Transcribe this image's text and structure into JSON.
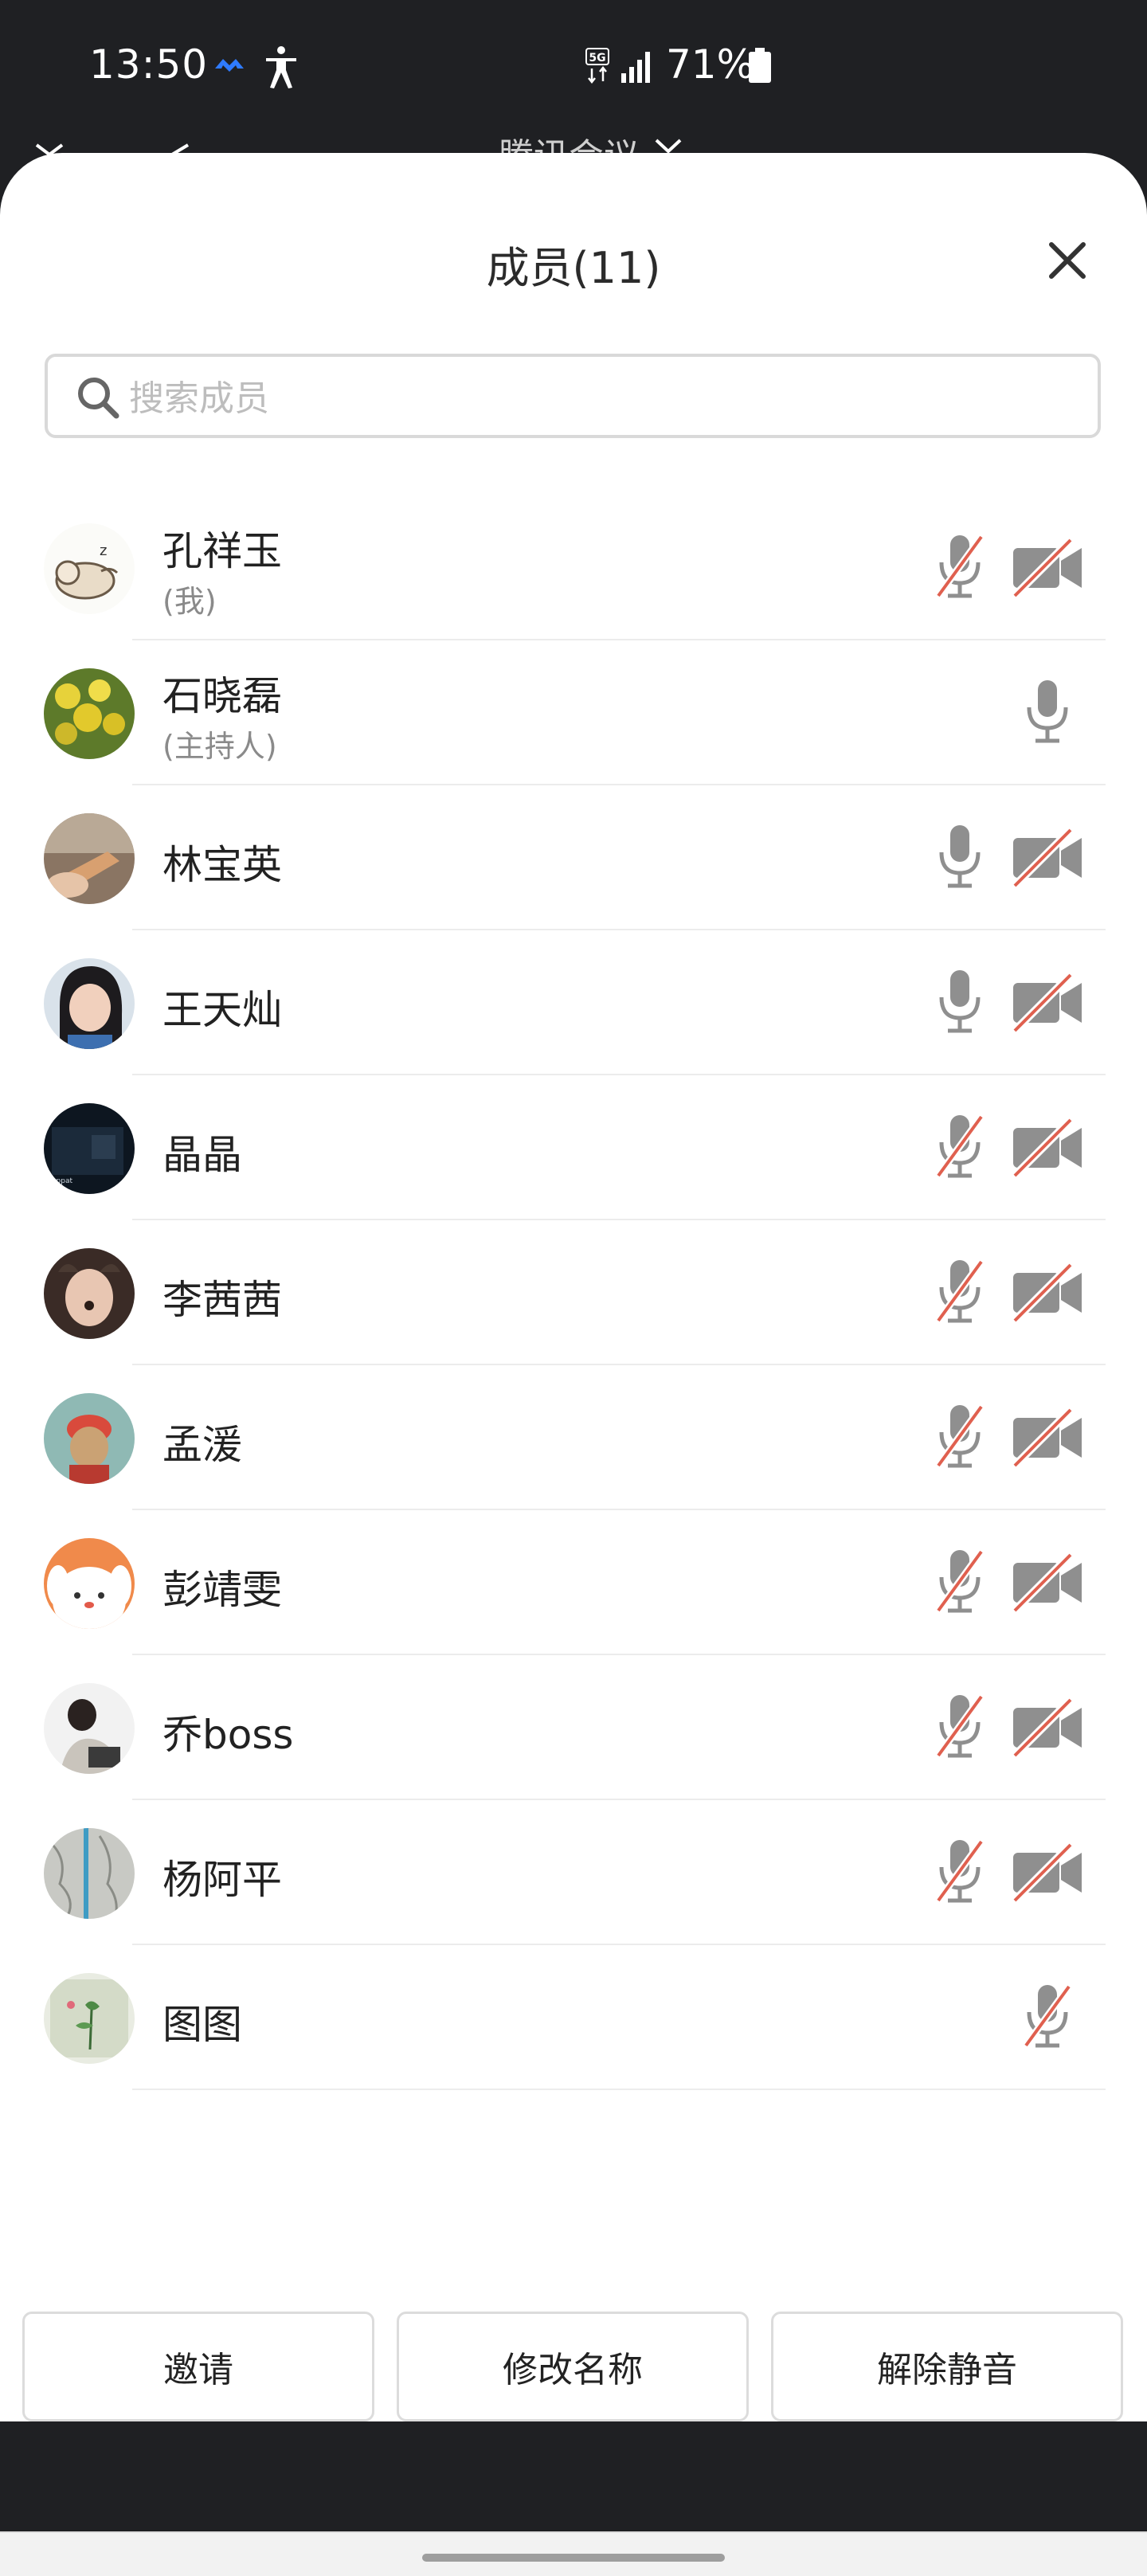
{
  "status_bar": {
    "time": "13:50",
    "network": "5G",
    "battery": "71%",
    "icons": [
      "app-notification-icon",
      "accessibility-icon",
      "5g-icon",
      "signal-icon",
      "battery-icon"
    ]
  },
  "background_app": {
    "title": "腾讯会议"
  },
  "panel": {
    "title": "成员(11)",
    "close_icon": "close-icon"
  },
  "search": {
    "placeholder": "搜索成员",
    "value": ""
  },
  "members": [
    {
      "name": "孔祥玉",
      "sub": "(我)",
      "mic": "muted",
      "camera": "off"
    },
    {
      "name": "石晓磊",
      "sub": "(主持人)",
      "mic": "on",
      "camera": "none"
    },
    {
      "name": "林宝英",
      "sub": "",
      "mic": "on",
      "camera": "off"
    },
    {
      "name": "王天灿",
      "sub": "",
      "mic": "on",
      "camera": "off"
    },
    {
      "name": "晶晶",
      "sub": "",
      "mic": "muted",
      "camera": "off"
    },
    {
      "name": "李茜茜",
      "sub": "",
      "mic": "muted",
      "camera": "off"
    },
    {
      "name": "孟湲",
      "sub": "",
      "mic": "muted",
      "camera": "off"
    },
    {
      "name": "彭靖雯",
      "sub": "",
      "mic": "muted",
      "camera": "off"
    },
    {
      "name": "乔boss",
      "sub": "",
      "mic": "muted",
      "camera": "off"
    },
    {
      "name": "杨阿平",
      "sub": "",
      "mic": "muted",
      "camera": "off"
    },
    {
      "name": "图图",
      "sub": "",
      "mic": "muted",
      "camera": "none"
    }
  ],
  "actions": {
    "invite": "邀请",
    "rename": "修改名称",
    "unmute": "解除静音"
  },
  "colors": {
    "icon_gray": "#8f8f8f",
    "muted_red": "#e0604f",
    "status_bar_bg": "#1f2023",
    "app_accent": "#2f7bff"
  }
}
